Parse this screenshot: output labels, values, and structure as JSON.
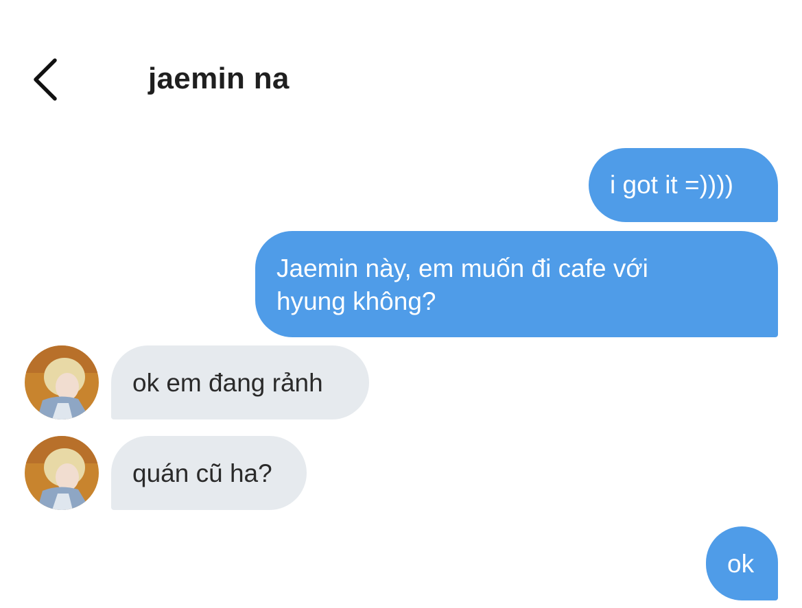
{
  "header": {
    "title": "jaemin na",
    "back_icon": "chevron-left-icon"
  },
  "colors": {
    "outgoing_bubble": "#4f9ce8",
    "incoming_bubble": "#e6eaee",
    "outgoing_text": "#ffffff",
    "incoming_text": "#2a2a2a"
  },
  "messages": [
    {
      "direction": "outgoing",
      "text": "i got it =))))"
    },
    {
      "direction": "outgoing",
      "text_line1": "Jaemin này, em muốn đi cafe với",
      "text_line2": "hyung không?"
    },
    {
      "direction": "incoming",
      "text": "ok em đang rảnh",
      "avatar": "contact-avatar"
    },
    {
      "direction": "incoming",
      "text": "quán cũ ha?",
      "avatar": "contact-avatar"
    },
    {
      "direction": "outgoing",
      "text": "ok"
    }
  ]
}
